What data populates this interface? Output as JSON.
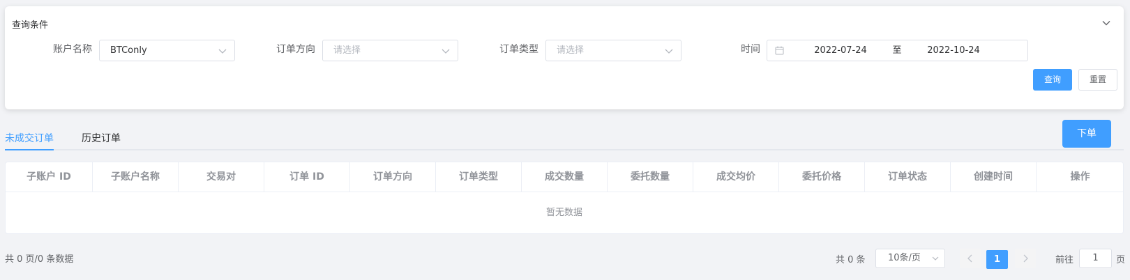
{
  "query": {
    "title": "查询条件",
    "account_label": "账户名称",
    "account_value": "BTConly",
    "direction_label": "订单方向",
    "direction_placeholder": "请选择",
    "type_label": "订单类型",
    "type_placeholder": "请选择",
    "time_label": "时间",
    "date_start": "2022-07-24",
    "date_sep": "至",
    "date_end": "2022-10-24",
    "query_button": "查询",
    "reset_button": "重置"
  },
  "tabs": [
    {
      "label": "未成交订单",
      "active": true
    },
    {
      "label": "历史订单",
      "active": false
    }
  ],
  "place_order_button": "下单",
  "table": {
    "columns": [
      "子账户 ID",
      "子账户名称",
      "交易对",
      "订单 ID",
      "订单方向",
      "订单类型",
      "成交数量",
      "委托数量",
      "成交均价",
      "委托价格",
      "订单状态",
      "创建时间",
      "操作"
    ],
    "empty_text": "暂无数据"
  },
  "pagination": {
    "summary_left": "共 0 页/0 条数据",
    "total": "共 0 条",
    "page_size": "10条/页",
    "current_page": "1",
    "jump_label": "前往",
    "jump_value": "1",
    "jump_suffix": "页"
  },
  "colors": {
    "primary": "#409eff",
    "background": "#f2f3f6"
  }
}
